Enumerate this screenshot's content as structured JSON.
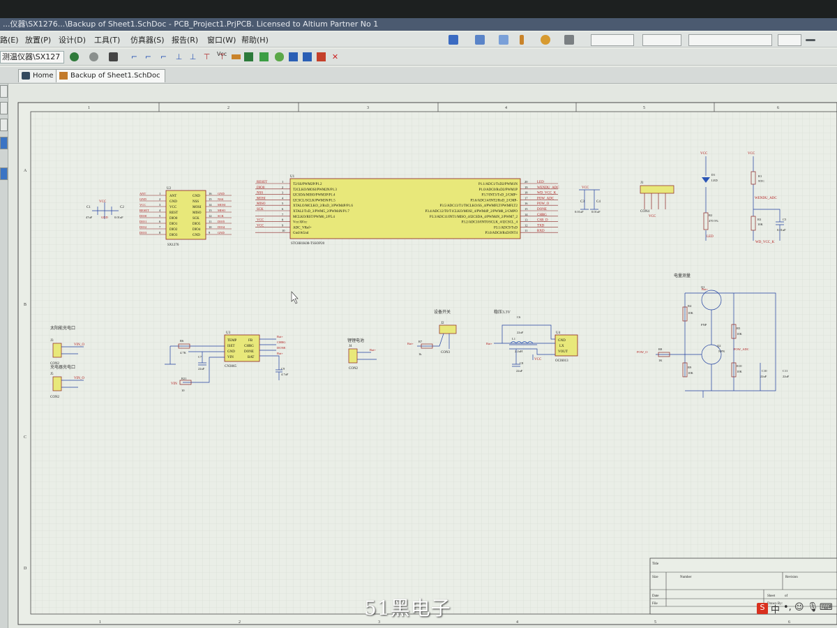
{
  "window": {
    "title": "...仪器\\SX1276...\\Backup of Sheet1.SchDoc - PCB_Project1.PrjPCB. Licensed to Altium Partner No 1"
  },
  "menu": {
    "items": [
      "路(E)",
      "放置(P)",
      "设计(D)",
      "工具(T)",
      "仿真器(S)",
      "报告(R)",
      "窗口(W)",
      "帮助(H)"
    ]
  },
  "toolbar": {
    "project_combo": "测温仪器\\SX127",
    "vcc_label": "Vcc"
  },
  "tabs": [
    {
      "label": "Home"
    },
    {
      "label": "Backup of Sheet1.SchDoc"
    }
  ],
  "sheet": {
    "columns": [
      "1",
      "2",
      "3",
      "4",
      "5",
      "6"
    ],
    "rows": [
      "A",
      "B",
      "C",
      "D"
    ]
  },
  "schematic": {
    "sx1276": {
      "ref": "U2",
      "part": "SX1276",
      "left_pins": [
        "ANT",
        "GND",
        "VCC",
        "REST",
        "DIO0",
        "DIO1",
        "DIO2",
        "DIO3"
      ],
      "left_nums": [
        "1",
        "2",
        "3",
        "4",
        "5",
        "6",
        "7",
        "8"
      ],
      "right_pins": [
        "GND",
        "NSS",
        "MOSI",
        "MISO",
        "SCK",
        "DIO5",
        "DIO4",
        "GND"
      ],
      "right_nums": [
        "16",
        "15",
        "14",
        "13",
        "12",
        "11",
        "10",
        "9"
      ],
      "left_nets": [
        "ANT",
        "GND",
        "VCC",
        "RESET",
        "DIO0",
        "DIO1",
        "DIO2",
        "DIO3"
      ],
      "right_nets": [
        "GND",
        "NSS",
        "MOSI",
        "MISO",
        "SCK",
        "DIO5",
        "DIO4",
        "GND"
      ],
      "cap1": "C1",
      "cap1_val": "47uF",
      "cap2": "C2",
      "cap2_val": "0.01uF",
      "vcc": "VCC",
      "gnd": "GND"
    },
    "mcu": {
      "ref": "U1",
      "part": "STC8H1K08-TSSOP20",
      "left_pins": [
        "T2/SS/PWM2P/P1.2",
        "T2CLKO/MOSI/PWM2N/P1.3",
        "I2CSDA/MISO/PWM3P/P1.4",
        "I2CSCL/SCLK/PWM3N/P1.5",
        "XTALO/MCLKO_2/RxD_3/PWM4P/P1.6",
        "XTALI/TxD_3/PWM5_2/PWM4N/P1.7",
        "MCLKO/RST/PWM6_2/P5.4",
        "Vcc/AVcc",
        "ADC_VRef+",
        "Gnd/AGnd"
      ],
      "left_nums": [
        "1",
        "2",
        "3",
        "4",
        "5",
        "6",
        "7",
        "8",
        "9",
        "10"
      ],
      "left_nets": [
        "RESET",
        "DIO0",
        "NSS",
        "MOSI",
        "MISO",
        "SCK",
        "",
        "VCC",
        "VCC",
        ""
      ],
      "right_pins": [
        "P1.1/ADC1/TxD2/PWM1N",
        "P1.0/ADC0/RxD2/PWM1P",
        "P3.7/INT3/TxD_2/CMP+",
        "P3.6/ADC14/INT2/RxD_2/CMP-",
        "P3.5/ADC13/T1/T0CLKO/SS_4/PWMFLT/PWMFLT2",
        "P3.4/ADC12/T0/T1CLKO/MOSI_4/PWM4P_2/PWM8_2/CMPO",
        "P3.3/ADC11/INT1/MISO_4/I2CSDA_4/PWM4N_2/PWM7_2",
        "P3.2/ADC10/INT0/SCLK_4/I2CSCL_4",
        "P3.1/ADC9/TxD",
        "P3.0/ADC8/RxD/INT4"
      ],
      "right_nums": [
        "20",
        "19",
        "18",
        "17",
        "16",
        "15",
        "14",
        "13",
        "12",
        "11"
      ],
      "right_nets": [
        "LED",
        "WENDU_ADC",
        "WD_VCC_K",
        "POW_ADC",
        "POW_O",
        "DONE",
        "CHRG",
        "CSB_D",
        "TXD",
        "RXD"
      ]
    },
    "cap_pair": {
      "c3": "C3",
      "c4": "C4",
      "c3_val": "0.01uF",
      "c4_val": "0.01uF",
      "vcc": "VCC"
    },
    "prog_header": {
      "ref": "J1",
      "part": "CON4",
      "vcc": "VCC"
    },
    "led_block": {
      "vcc": "VCC",
      "d": "D1",
      "d_val": "LED",
      "r": "R2",
      "r_val": "470 5%",
      "net": "LED"
    },
    "ntc_block": {
      "vcc": "VCC",
      "r1": "R1",
      "r1_val": "NTC",
      "net": "WENDU_ADC",
      "r3": "R3",
      "r3_val": "10K",
      "c5": "C5",
      "c5_val": "0.01uF",
      "wdk": "WD_VCC_K"
    },
    "solar": {
      "label": "太阳能充电口",
      "j": "J3",
      "part": "CON2",
      "vin": "VIN_O"
    },
    "charge_in": {
      "label": "充电器充电口",
      "j": "J5",
      "part": "CON2",
      "vin": "VIN_O"
    },
    "charger": {
      "ref": "U3",
      "part": "CN3065",
      "pins": [
        "TEMP",
        "ISET",
        "GND",
        "VIN",
        "FB",
        "CHRG",
        "DONE",
        "BAT"
      ],
      "r6": "R6",
      "r6_val": "4.7K",
      "c7": "C7",
      "c7_val": "22uF",
      "r21": "R21",
      "r21_val": "10",
      "c9": "C9",
      "c9_val": "4.7uF",
      "vin": "VIN",
      "nets": [
        "Bat+",
        "CHRG",
        "DONE",
        "Bat+"
      ]
    },
    "battery": {
      "label": "锂锂电池",
      "j": "J4",
      "part": "CON2",
      "net": "Bat+"
    },
    "switch": {
      "label": "设备开关",
      "j": "J2",
      "part": "CON3",
      "r7": "R7",
      "r7_val": "1k",
      "net": "Bat+"
    },
    "regulator": {
      "label": "稳压3.3V",
      "ref": "U4",
      "part": "OCI6013",
      "pins": [
        "GND",
        "LX",
        "VOUT"
      ],
      "c6": "C6",
      "c6_val": "22uF",
      "l1": "L1",
      "l1_val": "2.2uH",
      "c8": "C8",
      "c8_val": "22uF",
      "vcc": "VCC",
      "net": "Bat+"
    },
    "power_meas": {
      "label": "电量测量",
      "q1": "Q1",
      "q1_type": "PNP",
      "q2": "Q2",
      "q2_type": "NPN",
      "r4": "R4",
      "r4_val": "10K",
      "r5": "R5",
      "r5_val": "10K",
      "r8": "R8",
      "r8_val": "1K",
      "r9": "R9",
      "r9_val": "10K",
      "r10": "R10",
      "r10_val": "10K",
      "c10": "C10",
      "c10_val": "22uF",
      "c11": "C11",
      "c11_val": "22uF",
      "pow_o": "POW_O",
      "pow_adc": "POW_ADC",
      "net": "Bat+"
    },
    "title_block": {
      "title": "Title",
      "size": "Size",
      "number": "Number",
      "revision": "Revision",
      "date": "Date",
      "file": "File",
      "sheet": "Sheet",
      "of": "of",
      "drawn": "Drawn By:"
    }
  },
  "watermark": "51黑电子",
  "tray": {
    "ime": "中",
    "punct": "•,",
    "items": [
      "☺",
      "🎙",
      "⌨"
    ]
  },
  "colors": {
    "titlebar": "#4b5a70",
    "sheet": "#e3e7e1",
    "component": "#e8e87a",
    "wire": "#1f3fa0",
    "net": "#b01818",
    "border": "#3b3b3b"
  }
}
